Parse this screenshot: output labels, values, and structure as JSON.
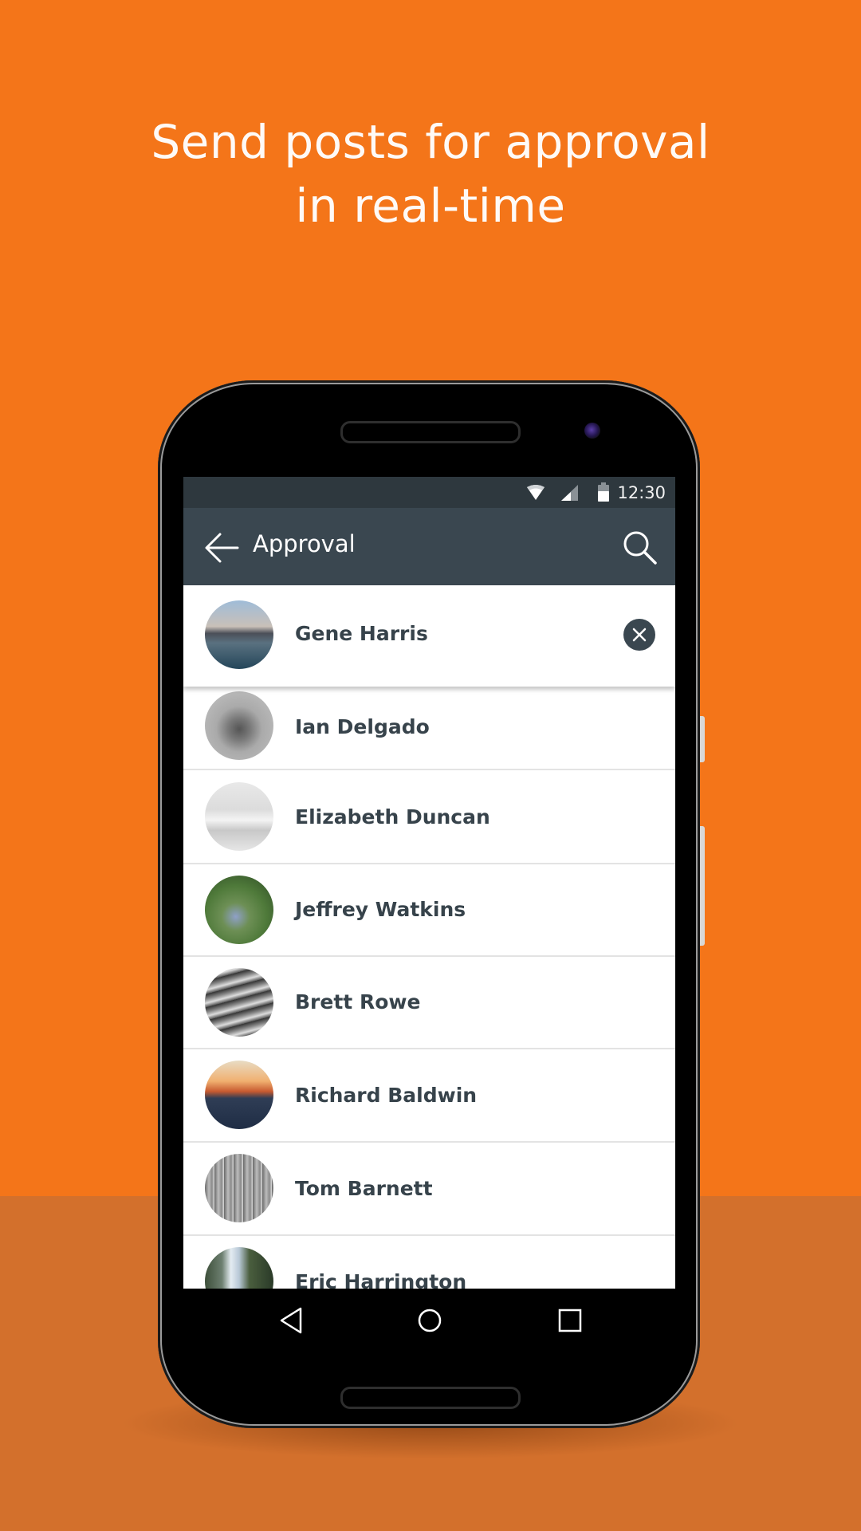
{
  "headline": {
    "line1": "Send posts for approval",
    "line2": "in real-time"
  },
  "colors": {
    "background": "#F47519",
    "band": "#D3702C",
    "appbar": "#3A4750",
    "statusbar": "#2E383E",
    "name_text": "#37434B"
  },
  "status_bar": {
    "time": "12:30",
    "icons": [
      "wifi-icon",
      "cell-signal-icon",
      "battery-icon"
    ]
  },
  "app_bar": {
    "title": "Approval",
    "back_icon": "arrow-left-icon",
    "search_icon": "search-icon"
  },
  "pinned_contact": {
    "name": "Gene Harris",
    "avatar": "city-waterfront-photo",
    "action_icon": "close-circle-icon"
  },
  "contacts": [
    {
      "name": "Ian Delgado",
      "avatar": "man-portrait-photo"
    },
    {
      "name": "Elizabeth Duncan",
      "avatar": "white-object-photo"
    },
    {
      "name": "Jeffrey Watkins",
      "avatar": "juniper-plant-photo"
    },
    {
      "name": "Brett Rowe",
      "avatar": "mountain-bw-photo"
    },
    {
      "name": "Richard Baldwin",
      "avatar": "sunset-hills-photo"
    },
    {
      "name": "Tom Barnett",
      "avatar": "buildings-bw-photo"
    },
    {
      "name": "Eric Harrington",
      "avatar": "waterfall-photo"
    }
  ],
  "nav_bar": {
    "back": "nav-back-icon",
    "home": "nav-home-icon",
    "recents": "nav-recents-icon"
  }
}
